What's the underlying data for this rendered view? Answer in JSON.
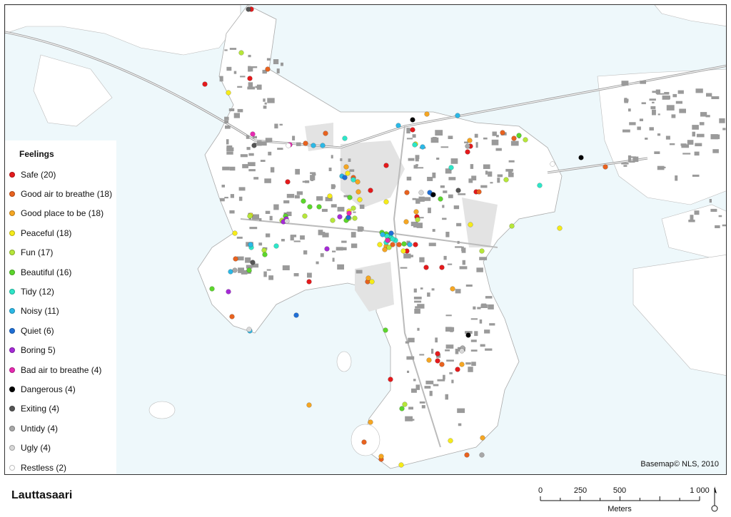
{
  "title": "Lauttasaari",
  "attribution": "Basemap© NLS, 2010",
  "legend": {
    "title": "Feelings",
    "items": [
      {
        "label": "Safe (20)",
        "color": "#e41a1c"
      },
      {
        "label": "Good air to breathe (18)",
        "color": "#e8621f"
      },
      {
        "label": "Good place to be (18)",
        "color": "#f5a623"
      },
      {
        "label": "Peaceful (18)",
        "color": "#f5eb1a"
      },
      {
        "label": "Fun (17)",
        "color": "#b6e63a"
      },
      {
        "label": "Beautiful (16)",
        "color": "#5cd62c"
      },
      {
        "label": "Tidy (12)",
        "color": "#2ee6c8"
      },
      {
        "label": "Noisy (11)",
        "color": "#2bb8e6"
      },
      {
        "label": "Quiet (6)",
        "color": "#1f6fd6"
      },
      {
        "label": "Boring 5)",
        "color": "#a52ad6"
      },
      {
        "label": "Bad air to breathe (4)",
        "color": "#e62ab0"
      },
      {
        "label": "Dangerous (4)",
        "color": "#000000"
      },
      {
        "label": "Exiting (4)",
        "color": "#555555"
      },
      {
        "label": "Untidy (4)",
        "color": "#a8a8a8"
      },
      {
        "label": "Ugly (4)",
        "color": "#d8d8d8"
      },
      {
        "label": "Restless (2)",
        "color": "#ffffff"
      }
    ]
  },
  "scale": {
    "ticks": [
      "0",
      "250",
      "500",
      "1 000"
    ],
    "unit": "Meters"
  }
}
